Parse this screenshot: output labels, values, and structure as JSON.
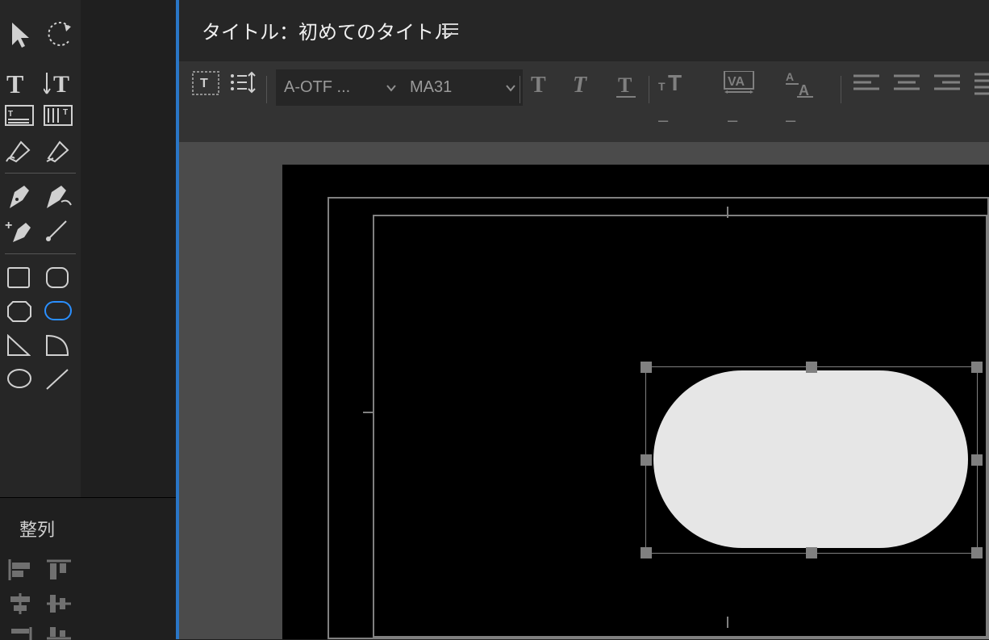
{
  "header": {
    "title_prefix": "タイトル：",
    "title_name": "初めてのタイトル"
  },
  "toolbar": {
    "font_family": "A-OTF ...",
    "font_style": "MA31"
  },
  "panels": {
    "align_title": "整列"
  },
  "tools": {
    "selection": "selection-tool",
    "rotate": "rotate-tool",
    "type": "type-tool",
    "vertical_type": "vertical-type-tool",
    "area_type": "area-type-tool",
    "path_type": "path-type-tool",
    "pen_drag": "pen-drag-tool",
    "pen_drag2": "pen-drag2-tool",
    "pen": "pen-tool",
    "pen_convert": "pen-convert-tool",
    "add_anchor": "add-anchor-tool",
    "line_pen": "direct-line-tool",
    "rect": "rectangle-tool",
    "round_rect": "rounded-rectangle-tool",
    "clipped": "clipped-corner-tool",
    "round_corner": "round-corner-rect-tool",
    "wedge": "wedge-tool",
    "arc": "arc-tool",
    "ellipse": "ellipse-tool",
    "line": "line-tool"
  }
}
